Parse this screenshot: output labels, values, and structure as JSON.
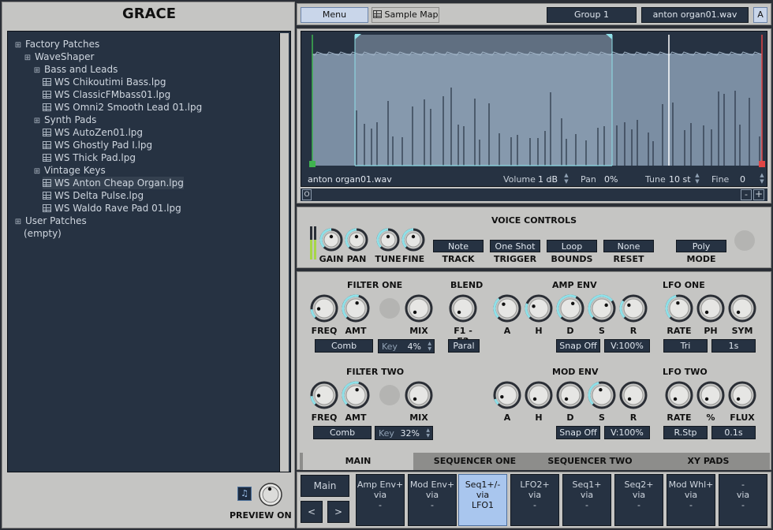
{
  "app": {
    "title": "GRACE"
  },
  "browser": {
    "tree": [
      {
        "label": "Factory Patches",
        "kind": "folder",
        "level": 0
      },
      {
        "label": "WaveShaper",
        "kind": "folder",
        "level": 1
      },
      {
        "label": "Bass and Leads",
        "kind": "folder",
        "level": 2
      },
      {
        "label": "WS Chikoutimi Bass.lpg",
        "kind": "file",
        "level": 3
      },
      {
        "label": "WS ClassicFMbass01.lpg",
        "kind": "file",
        "level": 3
      },
      {
        "label": "WS Omni2 Smooth Lead 01.lpg",
        "kind": "file",
        "level": 3
      },
      {
        "label": "Synth Pads",
        "kind": "folder",
        "level": 2
      },
      {
        "label": "WS AutoZen01.lpg",
        "kind": "file",
        "level": 3
      },
      {
        "label": "WS Ghostly Pad I.lpg",
        "kind": "file",
        "level": 3
      },
      {
        "label": "WS Thick Pad.lpg",
        "kind": "file",
        "level": 3
      },
      {
        "label": "Vintage Keys",
        "kind": "folder",
        "level": 2
      },
      {
        "label": "WS Anton Cheap Organ.lpg",
        "kind": "file",
        "level": 3,
        "selected": true
      },
      {
        "label": "WS Delta Pulse.lpg",
        "kind": "file",
        "level": 3
      },
      {
        "label": "WS Waldo Rave Pad 01.lpg",
        "kind": "file",
        "level": 3
      },
      {
        "label": "User Patches",
        "kind": "folder",
        "level": 0
      },
      {
        "label": "(empty)",
        "kind": "text",
        "level": 1
      }
    ],
    "preview_label": "PREVIEW ON"
  },
  "toolbar": {
    "menu": "Menu",
    "sample_map": "Sample Map",
    "group": "Group 1",
    "file": "anton organ01.wav",
    "a": "A"
  },
  "waveform": {
    "filename": "anton organ01.wav",
    "volume_label": "Volume",
    "volume_value": "1 dB",
    "pan_label": "Pan",
    "pan_value": "0%",
    "tune_label": "Tune",
    "tune_value": "10 st",
    "fine_label": "Fine",
    "fine_value": "0",
    "scroll_o": "O",
    "zoom_out": "-",
    "zoom_in": "+"
  },
  "voice": {
    "title": "VOICE CONTROLS",
    "knobs": [
      "GAIN",
      "PAN",
      "TUNE",
      "FINE"
    ],
    "track": {
      "value": "Note",
      "label": "TRACK"
    },
    "trigger": {
      "value": "One Shot",
      "label": "TRIGGER"
    },
    "bounds": {
      "value": "Loop",
      "label": "BOUNDS"
    },
    "reset": {
      "value": "None",
      "label": "RESET"
    },
    "mode": {
      "value": "Poly",
      "label": "MODE"
    }
  },
  "filter_one": {
    "title": "FILTER ONE",
    "freq": "FREQ",
    "amt": "AMT",
    "mix": "MIX",
    "type": "Comb",
    "key_label": "Key",
    "key_value": "4%"
  },
  "blend": {
    "title": "BLEND",
    "knob": "F1 - F2",
    "mode": "Paral"
  },
  "amp_env": {
    "title": "AMP ENV",
    "knobs": [
      "A",
      "H",
      "D",
      "S",
      "R"
    ],
    "snap": "Snap Off",
    "vel": "V:100%"
  },
  "lfo_one": {
    "title": "LFO ONE",
    "rate": "RATE",
    "ph": "PH",
    "sym": "SYM",
    "shape": "Tri",
    "time": "1s"
  },
  "filter_two": {
    "title": "FILTER TWO",
    "freq": "FREQ",
    "amt": "AMT",
    "mix": "MIX",
    "type": "Comb",
    "key_label": "Key",
    "key_value": "32%"
  },
  "mod_env": {
    "title": "MOD ENV",
    "knobs": [
      "A",
      "H",
      "D",
      "S",
      "R"
    ],
    "snap": "Snap Off",
    "vel": "V:100%"
  },
  "lfo_two": {
    "title": "LFO TWO",
    "rate": "RATE",
    "pct": "%",
    "flux": "FLUX",
    "shape": "R.Stp",
    "time": "0.1s"
  },
  "tabs": [
    "MAIN",
    "SEQUENCER ONE",
    "SEQUENCER TWO",
    "XY PADS"
  ],
  "mod_slots": {
    "main": "Main",
    "prev": "<",
    "next": ">",
    "slots": [
      {
        "src": "Amp Env+",
        "via": "via",
        "dst": "-"
      },
      {
        "src": "Mod Env+",
        "via": "via",
        "dst": "-"
      },
      {
        "src": "Seq1+/-",
        "via": "via",
        "dst": "LFO1",
        "active": true
      },
      {
        "src": "LFO2+",
        "via": "via",
        "dst": "-"
      },
      {
        "src": "Seq1+",
        "via": "via",
        "dst": "-"
      },
      {
        "src": "Seq2+",
        "via": "via",
        "dst": "-"
      },
      {
        "src": "Mod Whl+",
        "via": "via",
        "dst": "-"
      },
      {
        "src": "-",
        "via": "via",
        "dst": "-"
      }
    ]
  },
  "colors": {
    "panel": "#c5c5c3",
    "dark": "#263242",
    "accent": "#8fe0e8",
    "selected": "#a9c6ee"
  }
}
